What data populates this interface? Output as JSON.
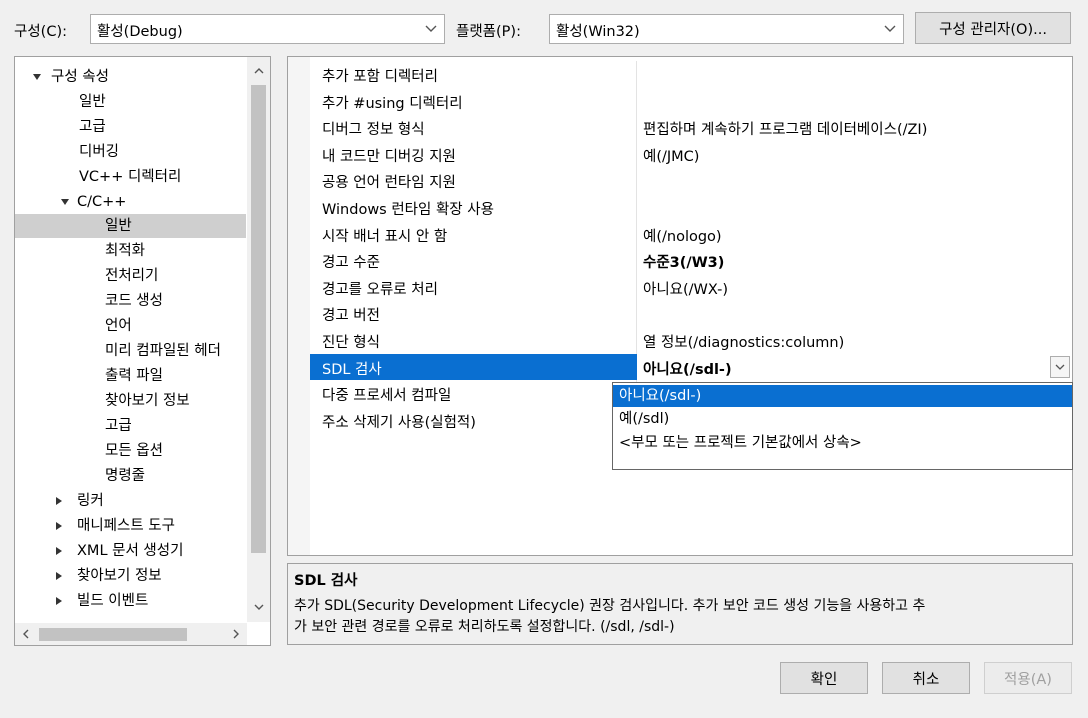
{
  "toolbar": {
    "config_label": "구성(C):",
    "config_value": "활성(Debug)",
    "platform_label": "플랫폼(P):",
    "platform_value": "활성(Win32)",
    "config_manager_button": "구성 관리자(O)..."
  },
  "tree": {
    "root": "구성 속성",
    "items": {
      "general": "일반",
      "advanced": "고급",
      "debugging": "디버깅",
      "vc_dirs": "VC++ 디렉터리",
      "cpp": "C/C++",
      "cpp_general": "일반",
      "cpp_optimization": "최적화",
      "cpp_preprocessor": "전처리기",
      "cpp_codegen": "코드 생성",
      "cpp_language": "언어",
      "cpp_pch": "미리 컴파일된 헤더",
      "cpp_output": "출력 파일",
      "cpp_browse": "찾아보기 정보",
      "cpp_advanced": "고급",
      "cpp_all": "모든 옵션",
      "cpp_cmdline": "명령줄",
      "linker": "링커",
      "manifest": "매니페스트 도구",
      "xmldoc": "XML 문서 생성기",
      "browse": "찾아보기 정보",
      "build_events": "빌드 이벤트"
    }
  },
  "grid": {
    "rows": [
      {
        "name": "추가 포함 디렉터리",
        "value": ""
      },
      {
        "name": "추가 #using 디렉터리",
        "value": ""
      },
      {
        "name": "디버그 정보 형식",
        "value": "편집하며 계속하기 프로그램 데이터베이스(/ZI)"
      },
      {
        "name": "내 코드만 디버깅 지원",
        "value": "예(/JMC)"
      },
      {
        "name": "공용 언어 런타임 지원",
        "value": ""
      },
      {
        "name": "Windows 런타임 확장 사용",
        "value": ""
      },
      {
        "name": "시작 배너 표시 안 함",
        "value": "예(/nologo)"
      },
      {
        "name": "경고 수준",
        "value": "수준3(/W3)"
      },
      {
        "name": "경고를 오류로 처리",
        "value": "아니요(/WX-)"
      },
      {
        "name": "경고 버전",
        "value": ""
      },
      {
        "name": "진단 형식",
        "value": "열 정보(/diagnostics:column)"
      },
      {
        "name": "SDL 검사",
        "value": "아니요(/sdl-)"
      },
      {
        "name": "다중 프로세서 컴파일",
        "value": ""
      },
      {
        "name": "주소 삭제기 사용(실험적)",
        "value": ""
      }
    ],
    "dropdown_options": [
      "아니요(/sdl-)",
      "예(/sdl)",
      "<부모 또는 프로젝트 기본값에서 상속>"
    ]
  },
  "description": {
    "title": "SDL 검사",
    "line1": "추가 SDL(Security Development Lifecycle) 권장 검사입니다. 추가 보안 코드 생성 기능을 사용하고 추",
    "line2": "가 보안 관련 경로를 오류로 처리하도록 설정합니다. (/sdl, /sdl-)"
  },
  "buttons": {
    "ok": "확인",
    "cancel": "취소",
    "apply": "적용(A)"
  }
}
